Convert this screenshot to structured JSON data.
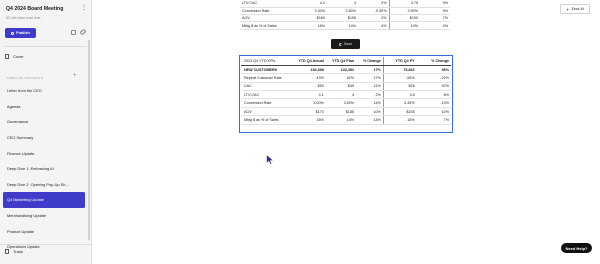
{
  "sidebar": {
    "title": "Q4 2024 Board Meeting",
    "more_icon": "more-vertical-icon",
    "subtitle": "63 min total read time",
    "publish_label": "Publish",
    "cover_label": "Cover",
    "toc_label": "TABLE OF CONTENTS",
    "toc_items": [
      "Letter from the CEO",
      "Agenda",
      "Governance",
      "CEO Summary",
      "Finance Update",
      "Deep Dive 1: Embracing AI",
      "Deep Dive 2: Opening Pop-Up Sh...",
      "Q4 Marketing Update",
      "Merchandising Update",
      "Product Update",
      "Operations Update"
    ],
    "active_index": 7,
    "trash_label": "Trash"
  },
  "top_table": {
    "rows": [
      [
        "LTV:CAC",
        "4.1",
        "4",
        "2%",
        "3.75",
        "9%"
      ],
      [
        "Conversion Rate",
        "3.20%",
        "3.50%",
        "-0.30%",
        "3.50%",
        "9%"
      ],
      [
        "AOV",
        "$160",
        "$155",
        "3%",
        "$150",
        "7%"
      ],
      [
        "Mktg $ as % of Sales",
        "18%",
        "14%",
        "4%",
        "14%",
        "4%"
      ]
    ]
  },
  "save_label": "Save",
  "main_table": {
    "headers": [
      "2023 Q4 YTD KPIs",
      "YTD Q4 Actual",
      "YTD Q4 Plan",
      "% Change",
      "YTD Q4 PY",
      "% Change"
    ],
    "rows": [
      [
        "NEW CUSTOMERS",
        "154,688",
        "132,452",
        "17%",
        "78,832",
        "96%"
      ],
      [
        "Repeat Customer Rate",
        "43%",
        "52%",
        "17%",
        "-55%",
        "-22%"
      ],
      [
        "CAC",
        "$50",
        "$45",
        "11%",
        "$26",
        "92%"
      ],
      [
        "LTV:CAC",
        "4.1",
        "4",
        "2%",
        "3.8",
        "8%"
      ],
      [
        "Conversion Rate",
        "3.00%",
        "3.50%",
        "14%",
        "3.45%",
        "-13%"
      ],
      [
        "AOV",
        "$170",
        "$155",
        "10%",
        "$155",
        "10%"
      ],
      [
        "Mktg $ as % of Sales",
        "16%",
        "14%",
        "14%",
        "15%",
        "7%"
      ]
    ]
  },
  "zeck_ai_label": "Zeck AI",
  "help_label": "Need Help?",
  "colors": {
    "accent": "#3e3cc9",
    "selection_border": "#3b6fd8",
    "sidebar_bg": "#f4f4f5"
  }
}
